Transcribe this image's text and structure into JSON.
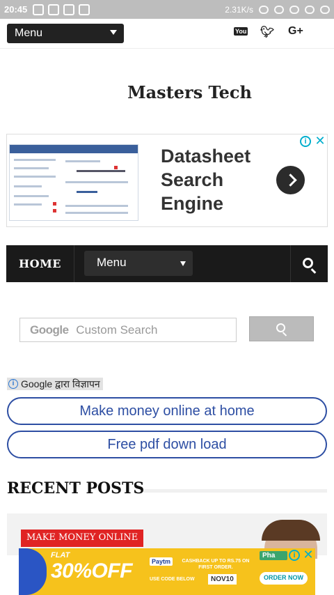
{
  "status_bar": {
    "time": "20:45",
    "speed": "2.31K/s"
  },
  "topbar": {
    "menu_label": "Menu",
    "social": [
      "youtube-icon",
      "twitter-icon",
      "google-plus-icon"
    ],
    "gplus_text": "G+",
    "youtube_text": "You"
  },
  "site": {
    "title": "Masters Tech"
  },
  "ad_banner": {
    "line1": "Datasheet",
    "line2": "Search",
    "line3": "Engine"
  },
  "nav": {
    "home": "HOME",
    "menu_label": "Menu"
  },
  "search": {
    "brand": "Google",
    "placeholder": "Custom Search"
  },
  "google_ads": {
    "label": "Google द्वारा विज्ञापन",
    "links": [
      "Make money online at home",
      "Free pdf down load"
    ]
  },
  "recent": {
    "title": "RECENT POSTS",
    "category": "MAKE MONEY ONLINE"
  },
  "bottom_ad": {
    "flat": "FLAT",
    "discount": "30%OFF",
    "paytm": "Paytm",
    "cashback": "CASHBACK UP TO RS.75 ON FIRST ORDER.",
    "code_label": "USE CODE BELOW",
    "code": "NOV10",
    "cta": "ORDER NOW",
    "brand": "Pha"
  },
  "colors": {
    "accent_red": "#e02424",
    "link_blue": "#2d4ea3",
    "nav_bg": "#1a1a1a",
    "ad_yellow": "#f6c21c"
  }
}
